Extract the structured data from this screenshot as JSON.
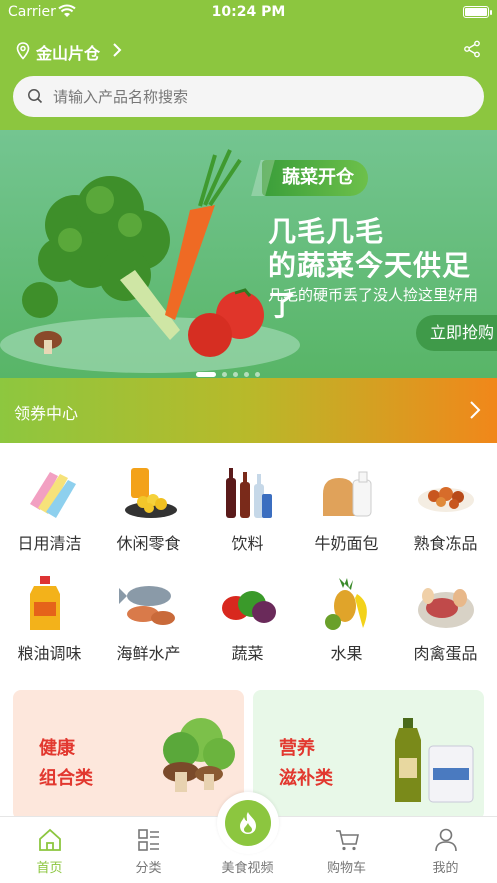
{
  "status_bar": {
    "carrier": "Carrier",
    "time": "10:24 PM"
  },
  "header": {
    "location": "金山片仓",
    "location_icon": "location-pin-icon",
    "share_icon": "share-icon"
  },
  "search": {
    "placeholder": "请输入产品名称搜索"
  },
  "banner": {
    "tag": "蔬菜开仓",
    "title_line1": "几毛几毛",
    "title_line2": "的蔬菜今天供足了",
    "subtitle": "几毛的硬币丢了没人捡这里好用",
    "button": "立即抢购",
    "dots_count": 5,
    "active_dot": 1
  },
  "coupon": {
    "label": "领券中心"
  },
  "categories": [
    {
      "label": "日用清洁",
      "icon": "cleaning-gloves-icon"
    },
    {
      "label": "休闲零食",
      "icon": "snacks-icon"
    },
    {
      "label": "饮料",
      "icon": "drinks-icon"
    },
    {
      "label": "牛奶面包",
      "icon": "milk-bread-icon"
    },
    {
      "label": "熟食冻品",
      "icon": "cooked-food-icon"
    },
    {
      "label": "粮油调味",
      "icon": "oil-icon"
    },
    {
      "label": "海鲜水产",
      "icon": "seafood-icon"
    },
    {
      "label": "蔬菜",
      "icon": "vegetables-icon"
    },
    {
      "label": "水果",
      "icon": "fruit-icon"
    },
    {
      "label": "肉禽蛋品",
      "icon": "meat-eggs-icon"
    }
  ],
  "promos": [
    {
      "line1": "健康",
      "line2": "组合类",
      "bg": "#fde7dc"
    },
    {
      "line1": "营养",
      "line2": "滋补类",
      "bg": "#e8f8e8"
    }
  ],
  "tabbar": [
    {
      "label": "首页",
      "icon": "home-icon",
      "active": true
    },
    {
      "label": "分类",
      "icon": "category-icon",
      "active": false
    },
    {
      "label": "美食视频",
      "icon": "video-flame-icon",
      "active": false
    },
    {
      "label": "购物车",
      "icon": "cart-icon",
      "active": false
    },
    {
      "label": "我的",
      "icon": "user-icon",
      "active": false
    }
  ],
  "colors": {
    "brand_green": "#8cc63f",
    "promo_red": "#e2382f",
    "coupon_orange": "#f1871a"
  }
}
